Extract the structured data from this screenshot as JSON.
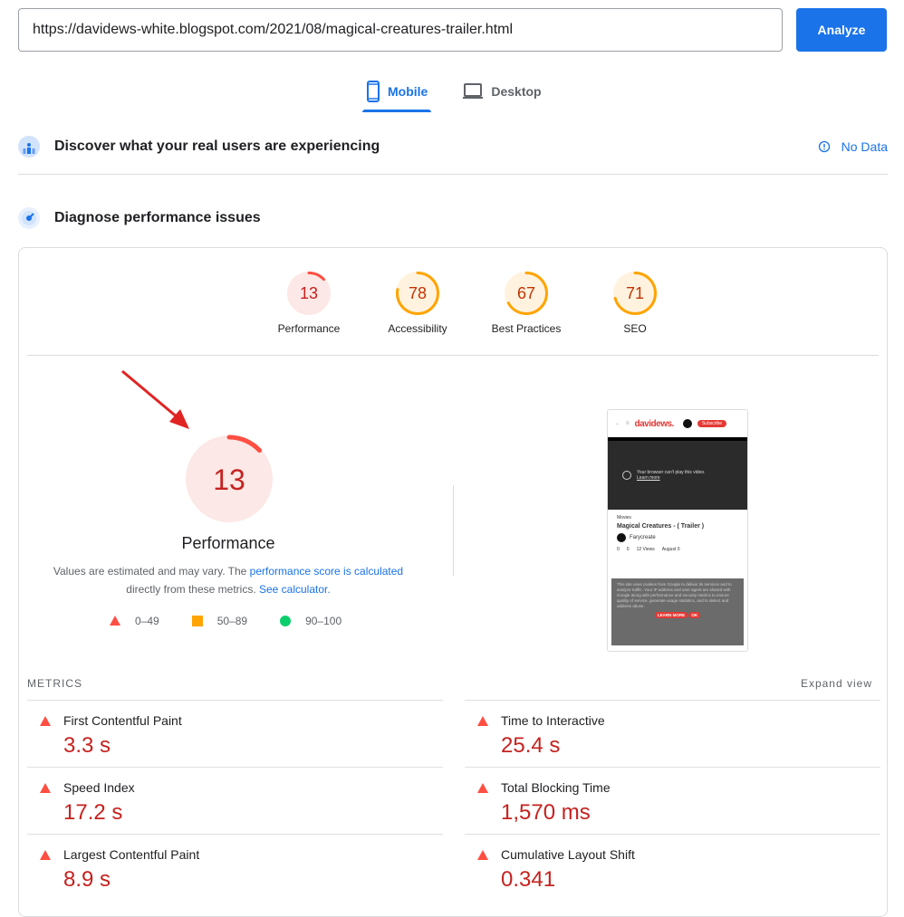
{
  "search": {
    "url_value": "https://davidews-white.blogspot.com/2021/08/magical-creatures-trailer.html",
    "analyze_label": "Analyze"
  },
  "tabs": [
    {
      "label": "Mobile",
      "icon": "phone-icon",
      "active": true
    },
    {
      "label": "Desktop",
      "icon": "laptop-icon",
      "active": false
    }
  ],
  "field_data": {
    "title": "Discover what your real users are experiencing",
    "status_icon": "info-icon",
    "status": "No Data"
  },
  "lab_data": {
    "title": "Diagnose performance issues"
  },
  "categories": [
    {
      "label": "Performance",
      "score": "13",
      "color": "#ff4e42"
    },
    {
      "label": "Accessibility",
      "score": "78",
      "color": "#ffa400"
    },
    {
      "label": "Best Practices",
      "score": "67",
      "color": "#ffa400"
    },
    {
      "label": "SEO",
      "score": "71",
      "color": "#ffa400"
    }
  ],
  "performance": {
    "score": "13",
    "title": "Performance",
    "desc_prefix": "Values are estimated and may vary. The ",
    "desc_link1": "performance score is calculated",
    "desc_mid": " directly from these metrics. ",
    "desc_link2": "See calculator."
  },
  "legend": [
    {
      "shape": "triangle",
      "range": "0–49",
      "color": "#ff4e42"
    },
    {
      "shape": "square",
      "range": "50–89",
      "color": "#ffa400"
    },
    {
      "shape": "circle",
      "range": "90–100",
      "color": "#0cce6b"
    }
  ],
  "preview": {
    "logo": "davidews.",
    "subscribe": "Subscribe",
    "video_msg": "Your browser can't play this video.",
    "video_link": "Learn more",
    "category": "Movies",
    "post_title": "Magical Creatures - ( Trailer )",
    "author": "Farycreate",
    "likes": "0",
    "comments": "0",
    "views": "12 Views",
    "date": "August 0",
    "cookie_text": "This site uses cookies from Google to deliver its services and to analyze traffic. Your IP address and user-agent are shared with Google along with performance and security metrics to ensure quality of service, generate usage statistics, and to detect and address abuse.",
    "learn_more": "LEARN MORE",
    "ok": "OK"
  },
  "metrics": {
    "header": "METRICS",
    "expand": "Expand view",
    "left": [
      {
        "name": "First Contentful Paint",
        "value": "3.3 s"
      },
      {
        "name": "Speed Index",
        "value": "17.2 s"
      },
      {
        "name": "Largest Contentful Paint",
        "value": "8.9 s"
      }
    ],
    "right": [
      {
        "name": "Time to Interactive",
        "value": "25.4 s"
      },
      {
        "name": "Total Blocking Time",
        "value": "1,570 ms"
      },
      {
        "name": "Cumulative Layout Shift",
        "value": "0.341"
      }
    ]
  }
}
